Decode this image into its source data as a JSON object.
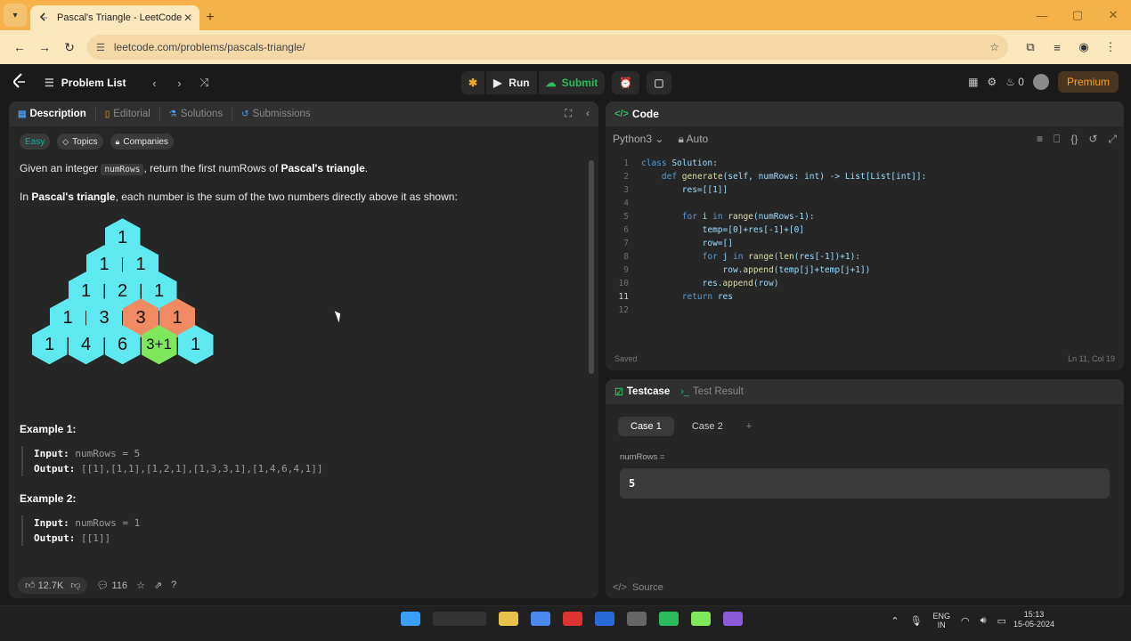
{
  "browser": {
    "tab_title": "Pascal's Triangle - LeetCode",
    "url": "leetcode.com/problems/pascals-triangle/"
  },
  "nav": {
    "problem_list": "Problem List",
    "run": "Run",
    "submit": "Submit",
    "streak": "0",
    "premium": "Premium"
  },
  "left": {
    "tabs": [
      "Description",
      "Editorial",
      "Solutions",
      "Submissions"
    ],
    "tags": {
      "difficulty": "Easy",
      "topics": "Topics",
      "companies": "Companies"
    },
    "para1_pre": "Given an integer ",
    "para1_code": "numRows",
    "para1_mid": ", return the first numRows of ",
    "para1_bold": "Pascal's triangle",
    "para1_post": ".",
    "para2_pre": "In ",
    "para2_bold": "Pascal's triangle",
    "para2_post": ", each number is the sum of the two numbers directly above it as shown:",
    "triangle": [
      [
        "1"
      ],
      [
        "1",
        "1"
      ],
      [
        "1",
        "2",
        "1"
      ],
      [
        "1",
        "3",
        "3",
        "1"
      ],
      [
        "1",
        "4",
        "6",
        "3+1",
        "1"
      ]
    ],
    "ex1_title": "Example 1:",
    "ex1_input_label": "Input:",
    "ex1_input": " numRows = 5",
    "ex1_output_label": "Output:",
    "ex1_output": " [[1],[1,1],[1,2,1],[1,3,3,1],[1,4,6,4,1]]",
    "ex2_title": "Example 2:",
    "ex2_input_label": "Input:",
    "ex2_input": " numRows = 1",
    "ex2_output_label": "Output:",
    "ex2_output": " [[1]]",
    "likes": "12.7K",
    "comments": "116"
  },
  "code": {
    "title": "Code",
    "language": "Python3",
    "mode": "Auto",
    "saved": "Saved",
    "cursor_pos": "Ln 11, Col 19",
    "lines": [
      "class Solution:",
      "    def generate(self, numRows: int) -> List[List[int]]:",
      "        res=[[1]]",
      "",
      "        for i in range(numRows-1):",
      "            temp=[0]+res[-1]+[0]",
      "            row=[]",
      "            for j in range(len(res[-1])+1):",
      "                row.append(temp[j]+temp[j+1])",
      "            res.append(row)",
      "        return res",
      ""
    ]
  },
  "test": {
    "tab_testcase": "Testcase",
    "tab_result": "Test Result",
    "case1": "Case 1",
    "case2": "Case 2",
    "add": "+",
    "var_label": "numRows =",
    "var_value": "5",
    "source": "Source"
  },
  "taskbar": {
    "lang1": "ENG",
    "lang2": "IN",
    "time": "15:13",
    "date": "15-05-2024"
  },
  "colors": {
    "accent_orange": "#ffa116",
    "green": "#2cbb5d",
    "hex_cyan": "#5ee9f1",
    "hex_orange": "#f08a63",
    "hex_green": "#7fe85a"
  }
}
